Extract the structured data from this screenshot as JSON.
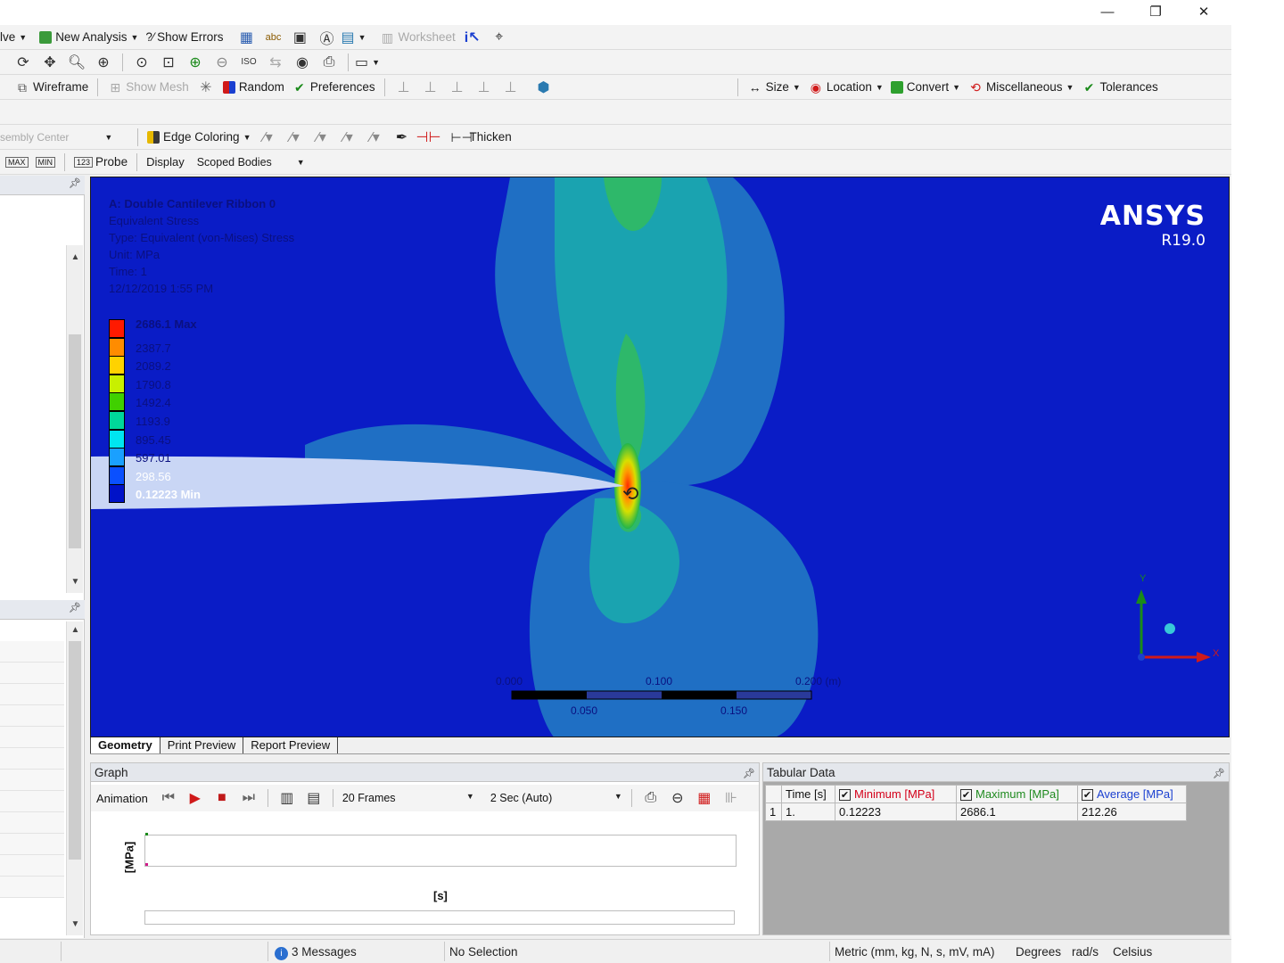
{
  "window": {
    "minimize": "—",
    "restore": "❐",
    "close": "✕"
  },
  "toolbar1": {
    "solve_label": "lve",
    "new_analysis": "New Analysis",
    "show_errors": "Show Errors",
    "show_errors_prefix": "?⁄",
    "worksheet": "Worksheet"
  },
  "toolbar3": {
    "wireframe": "Wireframe",
    "show_mesh": "Show Mesh",
    "random": "Random",
    "preferences": "Preferences",
    "size": "Size",
    "location": "Location",
    "convert": "Convert",
    "miscellaneous": "Miscellaneous",
    "tolerances": "Tolerances"
  },
  "toolbar5": {
    "assembly_center": "sembly Center",
    "edge_coloring": "Edge Coloring",
    "thicken": "Thicken"
  },
  "toolbar6": {
    "max_label": "MAX",
    "min_label": "MIN",
    "probe_prefix": "123",
    "probe": "Probe",
    "display": "Display",
    "scoped_bodies": "Scoped Bodies"
  },
  "viewport": {
    "logo": "ANSYS",
    "version": "R19.0",
    "result_title": "A: Double Cantilever Ribbon 0",
    "result_lines": [
      "Equivalent Stress",
      "Type: Equivalent (von-Mises) Stress",
      "Unit: MPa",
      "Time: 1",
      "12/12/2019 1:55 PM"
    ],
    "legend_values": [
      "2686.1 Max",
      "2387.7",
      "2089.2",
      "1790.8",
      "1492.4",
      "1193.9",
      "895.45",
      "597.01",
      "298.56",
      "0.12223 Min"
    ],
    "legend_colors": [
      "#ff1a00",
      "#ff8c00",
      "#ffd200",
      "#c8f000",
      "#40d000",
      "#00d89a",
      "#00e6f0",
      "#1aa0ff",
      "#0a50ff",
      "#0012c8"
    ],
    "scale_labels_top": [
      "0.000",
      "0.100",
      "0.200 (m)"
    ],
    "scale_labels_bottom": [
      "0.050",
      "0.150"
    ],
    "axis_y": "Y",
    "axis_x": "X"
  },
  "tabs": [
    "Geometry",
    "Print Preview",
    "Report Preview"
  ],
  "graph": {
    "title": "Graph",
    "animation": "Animation",
    "frames": "20 Frames",
    "duration": "2 Sec (Auto)",
    "ylabel": "[MPa]",
    "xlabel": "[s]"
  },
  "tabular": {
    "title": "Tabular Data",
    "headers": [
      "Time [s]",
      "Minimum [MPa]",
      "Maximum [MPa]",
      "Average [MPa]"
    ],
    "header_colors": [
      "#111111",
      "#d4001a",
      "#1e8a1e",
      "#1a3fd0"
    ],
    "row_index": "1",
    "row": [
      "1.",
      "0.12223",
      "2686.1",
      "212.26"
    ]
  },
  "status": {
    "messages": "3 Messages",
    "selection": "No Selection",
    "units": "Metric (mm, kg, N, s, mV, mA)",
    "angle": "Degrees",
    "rate": "rad/s",
    "temp": "Celsius"
  }
}
